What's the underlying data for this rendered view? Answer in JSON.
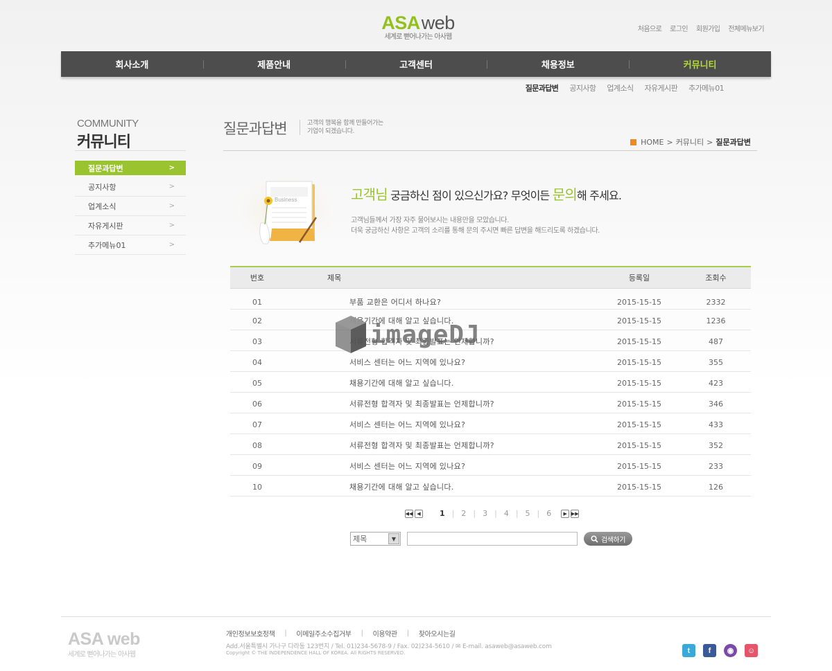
{
  "brand": {
    "name_part1": "ASA",
    "name_part2": "web",
    "tagline": "세계로 뻗어나가는 아사웹",
    "accent_color": "#93c11c"
  },
  "top_links": [
    "처음으로",
    "로그인",
    "회원가입",
    "전체메뉴보기"
  ],
  "gnb": {
    "items": [
      "회사소개",
      "제품안내",
      "고객센터",
      "채용정보",
      "커뮤니티"
    ],
    "active_index": 4
  },
  "sub_nav": {
    "items": [
      "질문과답변",
      "공지사항",
      "업계소식",
      "자유게시판",
      "추가메뉴01"
    ],
    "active_index": 0
  },
  "left_menu": {
    "title_en": "COMMUNITY",
    "title_ko": "커뮤니티",
    "items": [
      "질문과답변",
      "공지사항",
      "업계소식",
      "자유게시판",
      "추가메뉴01"
    ],
    "active_index": 0
  },
  "page": {
    "title": "질문과답변",
    "desc_line1": "고객의 행복을 함께 만들어가는",
    "desc_line2": "기업이 되겠습니다.",
    "breadcrumb": [
      "HOME",
      "커뮤니티",
      "질문과답변"
    ]
  },
  "banner": {
    "head_hl1": "고객님",
    "head_mid": " 궁금하신 점이 있으신가요? 무엇이든 ",
    "head_hl2": "문의",
    "head_end": "해 주세요.",
    "folder_label": "Business",
    "text_line1": "고객님들께서 가장 자주 물어보시는 내용만을 모았습니다.",
    "text_line2": "더욱 궁금하신 사항은 고객의 소리를 통해 문의 주시면 빠른 답변을 해드리도록 하겠습니다."
  },
  "board": {
    "columns": [
      "번호",
      "제목",
      "등록일",
      "조회수"
    ],
    "rows": [
      {
        "no": "01",
        "title": "부품 교환은 어디서 하나요?",
        "date": "2015-15-15",
        "views": "2332"
      },
      {
        "no": "02",
        "title": "채용기간에 대해 알고 싶습니다.",
        "date": "2015-15-15",
        "views": "1236"
      },
      {
        "no": "03",
        "title": "서류전형 합격자 및 최종발표는 언제합니까?",
        "date": "2015-15-15",
        "views": "487"
      },
      {
        "no": "04",
        "title": "서비스 센터는 어느 지역에 있나요?",
        "date": "2015-15-15",
        "views": "355"
      },
      {
        "no": "05",
        "title": "채용기간에 대해 알고 싶습니다.",
        "date": "2015-15-15",
        "views": "423"
      },
      {
        "no": "06",
        "title": "서류전형 합격자 및 최종발표는 언제합니까?",
        "date": "2015-15-15",
        "views": "346"
      },
      {
        "no": "07",
        "title": "서비스 센터는 어느 지역에 있나요?",
        "date": "2015-15-15",
        "views": "433"
      },
      {
        "no": "08",
        "title": "서류전형 합격자 및 최종발표는 언제합니까?",
        "date": "2015-15-15",
        "views": "352"
      },
      {
        "no": "09",
        "title": "서비스 센터는 어느 지역에 있나요?",
        "date": "2015-15-15",
        "views": "233"
      },
      {
        "no": "10",
        "title": "채용기간에 대해 알고 싶습니다.",
        "date": "2015-15-15",
        "views": "126"
      }
    ]
  },
  "pagination": {
    "pages": [
      "1",
      "2",
      "3",
      "4",
      "5",
      "6"
    ],
    "current": "1"
  },
  "search": {
    "select_value": "제목",
    "input_value": "",
    "button_label": "검색하기"
  },
  "footer": {
    "links": [
      "개인정보보호정책",
      "이메일주소수집거부",
      "이용약관",
      "찾아오시는길"
    ],
    "address": "Add.서울특별시 가나구 다라동 123번지  / Tel. 01)234-5678-9  / Fax. 02)234-5610  /",
    "email": "E-mail. asaweb@asaweb.com",
    "copyright": "Copyright © THE INDEPENDENCE HALL OF KOREA. All RIGHTS RESERVED."
  },
  "social_icons": [
    "twitter-icon",
    "facebook-icon",
    "messenger-icon",
    "blog-icon"
  ],
  "watermark": "imageDJ"
}
